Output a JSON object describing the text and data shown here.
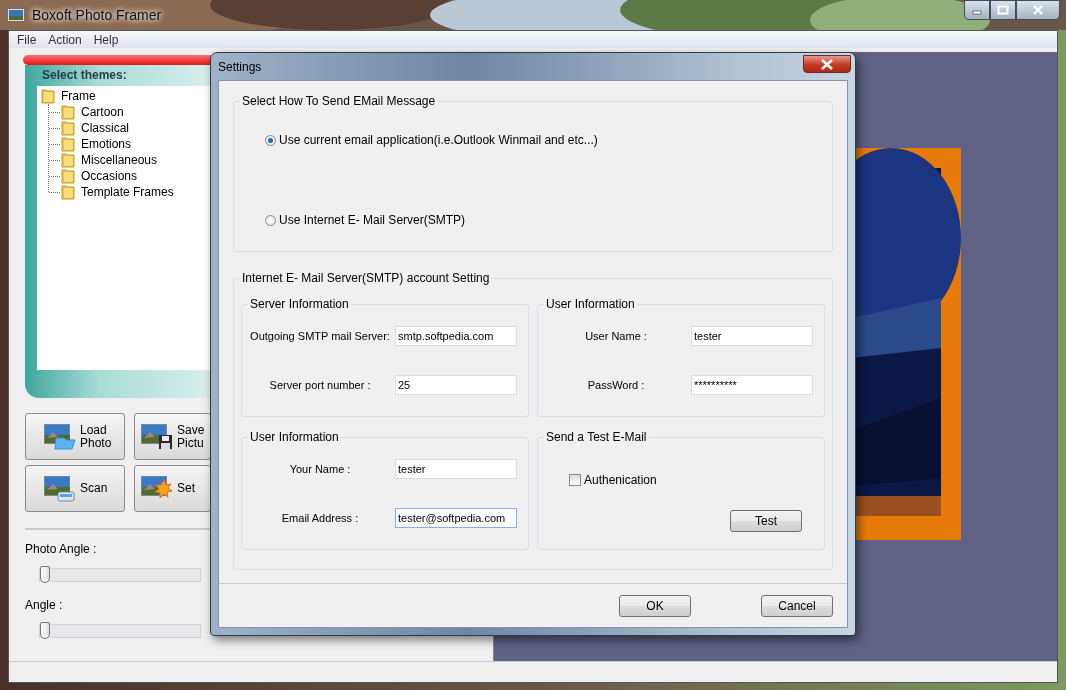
{
  "window": {
    "title": "Boxoft Photo Framer"
  },
  "menu": [
    "File",
    "Action",
    "Help"
  ],
  "themes": {
    "title": "Select themes:",
    "tree": [
      {
        "label": "Frame",
        "children": [
          {
            "label": "Cartoon"
          },
          {
            "label": "Classical"
          },
          {
            "label": "Emotions"
          },
          {
            "label": "Miscellaneous"
          },
          {
            "label": "Occasions"
          },
          {
            "label": "Template Frames"
          }
        ]
      }
    ]
  },
  "tools": [
    {
      "kind": "load",
      "lines": [
        "Load",
        "Photo"
      ]
    },
    {
      "kind": "save",
      "lines": [
        "Save",
        "Pictu"
      ]
    },
    {
      "kind": "scan",
      "lines": [
        "Scan"
      ]
    },
    {
      "kind": "settings",
      "lines": [
        "Set"
      ]
    }
  ],
  "sliders": [
    {
      "label": "Photo Angle :",
      "level": 0
    },
    {
      "label": "Angle :",
      "level": 0
    }
  ],
  "preview": {
    "kind": "picture"
  },
  "dialog": {
    "title": "Settings",
    "send_method": {
      "title": "Select How To Send EMail Message",
      "options": [
        {
          "label": "Use current email application(i.e.Outlook Winmail and etc...)",
          "selected": true
        },
        {
          "label": "Use Internet E- Mail Server(SMTP)",
          "selected": false
        }
      ]
    },
    "smtp": {
      "title": "Internet E- Mail Server(SMTP) account Setting",
      "groups": [
        {
          "kind": "fields",
          "title": "Server Information",
          "fields": [
            {
              "label": "Outgoing SMTP mail Server:",
              "value": "smtp.softpedia.com",
              "focused": false
            },
            {
              "label": "Server port number :",
              "value": "25",
              "focused": false
            }
          ]
        },
        {
          "kind": "fields",
          "title": "User Information",
          "fields": [
            {
              "label": "User Name :",
              "value": "tester",
              "focused": false
            },
            {
              "label": "PassWord :",
              "value": "**********",
              "focused": false
            }
          ]
        },
        {
          "kind": "fields",
          "title": "User Information",
          "fields": [
            {
              "label": "Your Name :",
              "value": "tester",
              "focused": false
            },
            {
              "label": "Email Address :",
              "value": "tester@softpedia.com",
              "focused": true
            }
          ]
        },
        {
          "kind": "test",
          "title": "Send a Test E-Mail",
          "checkbox": {
            "label": "Authenication",
            "checked": false
          },
          "button": "Test"
        }
      ]
    },
    "buttons": [
      "OK",
      "Cancel"
    ]
  }
}
